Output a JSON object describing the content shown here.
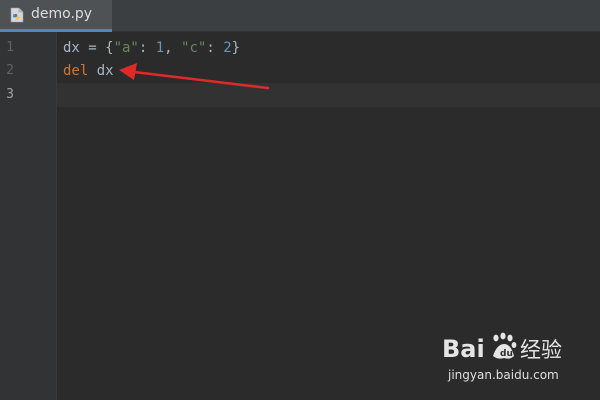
{
  "tab": {
    "filename": "demo.py",
    "icon": "python-file-icon"
  },
  "gutter": {
    "line_numbers": [
      "1",
      "2",
      "3"
    ]
  },
  "code": {
    "line1": {
      "t0": "dx = {",
      "t1": "\"a\"",
      "t2": ": ",
      "t3": "1",
      "t4": ", ",
      "t5": "\"c\"",
      "t6": ": ",
      "t7": "2",
      "t8": "}"
    },
    "line2": {
      "t0": "del",
      "t1": " dx"
    },
    "line3": ""
  },
  "annotation": {
    "arrow_color": "#e02a2a",
    "icon": "red-arrow-icon"
  },
  "watermark": {
    "brand_text": "Bai",
    "brand_suffix": "经验",
    "url": "jingyan.baidu.com"
  },
  "colors": {
    "background": "#2b2b2b",
    "keyword": "#cc7832",
    "string": "#6a8759",
    "number": "#6897bb",
    "identifier": "#a9b7c6",
    "tab_active_underline": "#4a88c7"
  }
}
